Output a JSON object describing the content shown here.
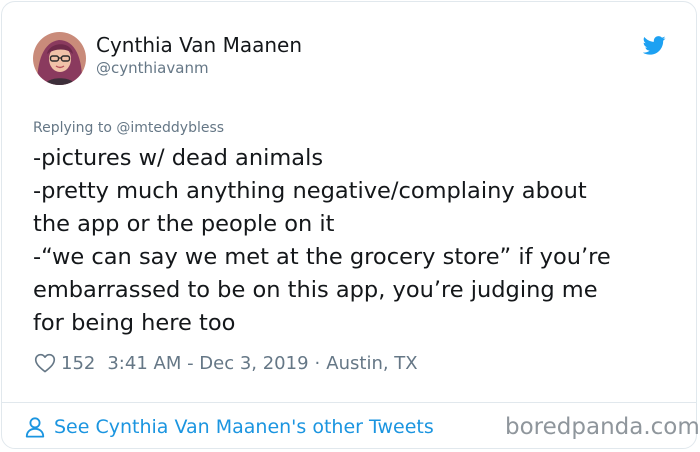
{
  "tweet": {
    "author_name": "Cynthia Van Maanen",
    "author_handle": "@cynthiavanm",
    "replying_to": "Replying to @imteddybless",
    "body_lines": [
      "-pictures w/ dead animals",
      "-pretty much anything negative/complainy about",
      "the app or the people on it",
      "-“we can say we met at the grocery store” if you’re",
      "embarrassed to be on this app, you’re judging me",
      "for being here too"
    ],
    "likes": "152",
    "timestamp": "3:41 AM - Dec 3, 2019",
    "separator": "·",
    "location": "Austin, TX"
  },
  "footer": {
    "see_more": "See Cynthia Van Maanen's other Tweets",
    "watermark": "boredpanda.com"
  },
  "icons": {
    "brand": "twitter-bird-icon",
    "like": "heart-outline-icon",
    "profile": "person-icon"
  },
  "colors": {
    "twitter_blue": "#1da1f2",
    "link_blue": "#1b95e0",
    "text": "#14171a",
    "muted": "#657786",
    "border": "#e1e8ed"
  }
}
